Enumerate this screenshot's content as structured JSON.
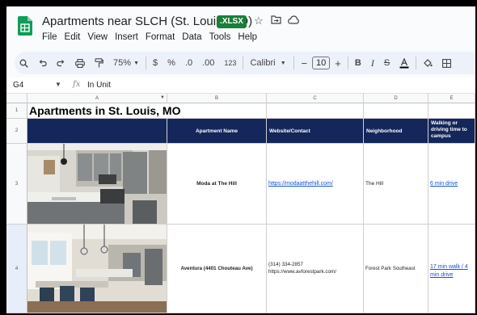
{
  "doc": {
    "title": "Apartments near SLCH (St. Louis, MO)",
    "extension": ".XLSX",
    "menu": [
      "File",
      "Edit",
      "View",
      "Insert",
      "Format",
      "Data",
      "Tools",
      "Help"
    ]
  },
  "toolbar": {
    "zoom": "75%",
    "currency": "$",
    "percent": "%",
    "decrease_decimal": ".0",
    "increase_decimal": ".00",
    "number_format": "123",
    "font": "Calibri",
    "font_size": "10",
    "minus": "−",
    "plus": "+",
    "bold": "B",
    "italic": "I"
  },
  "formula_bar": {
    "cell_ref": "G4",
    "fx": "fx",
    "value": "In Unit"
  },
  "columns": [
    "A",
    "B",
    "C",
    "D",
    "E"
  ],
  "rows": [
    "1",
    "2",
    "3",
    "4"
  ],
  "sheet": {
    "title": "Apartments in St. Louis, MO",
    "headers": {
      "name": "Apartment Name",
      "website": "Website/Contact",
      "neighborhood": "Neighborhood",
      "commute": "Walking or driving time to campus"
    },
    "listings": [
      {
        "name": "Moda at The Hill",
        "website": "https://modaatthehill.com/",
        "neighborhood": "The Hill",
        "commute": "6 min drive"
      },
      {
        "name": "Aventura (4401 Chouteau Ave)",
        "phone": "(314) 334-2857",
        "website": "https://www.avforestpark.com/",
        "neighborhood": "Forest Park Southeast",
        "commute": "17 min walk / 4 min drive"
      }
    ]
  },
  "colors": {
    "header_fill": "#14265a",
    "badge": "#188038",
    "link": "#1155cc"
  }
}
